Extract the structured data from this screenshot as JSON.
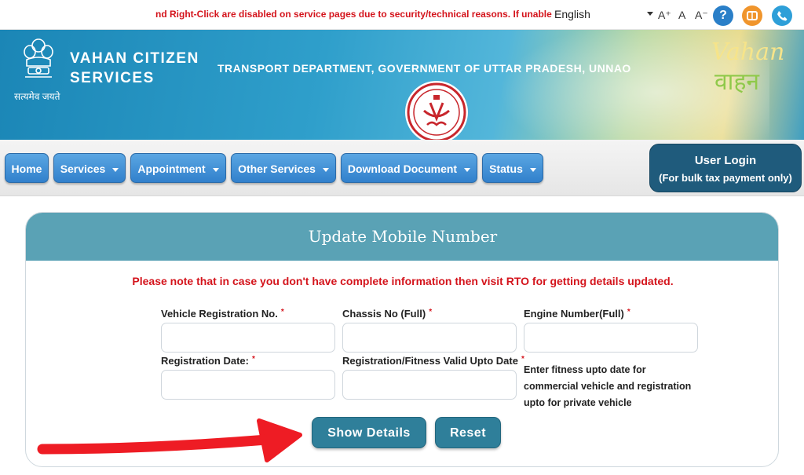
{
  "topbar": {
    "notice": "nd Right-Click are disabled on service pages due to security/technical reasons. If unable to",
    "language": "English",
    "font_increase": "A⁺",
    "font_normal": "A",
    "font_decrease": "A⁻",
    "help_icon_glyph": "?"
  },
  "header": {
    "brand_line1": "VAHAN CITIZEN",
    "brand_line2": "SERVICES",
    "emblem_caption": "सत्यमेव जयते",
    "department": "TRANSPORT DEPARTMENT, GOVERNMENT OF UTTAR PRADESH, UNNAO",
    "logo_text_en": "Vahan",
    "logo_text_hi": "वाहन"
  },
  "nav": {
    "items": [
      {
        "label": "Home"
      },
      {
        "label": "Services"
      },
      {
        "label": "Appointment"
      },
      {
        "label": "Other Services"
      },
      {
        "label": "Download Document"
      },
      {
        "label": "Status"
      }
    ],
    "login_title": "User Login",
    "login_sub": "(For bulk tax payment only)"
  },
  "form": {
    "title": "Update Mobile Number",
    "note": "Please note that in case you don't have complete information then visit RTO for getting details updated.",
    "fields": {
      "reg_no": {
        "label": "Vehicle Registration No.",
        "value": ""
      },
      "chassis": {
        "label": "Chassis No (Full)",
        "value": ""
      },
      "engine": {
        "label": "Engine Number(Full)",
        "value": ""
      },
      "reg_date": {
        "label": "Registration Date:",
        "value": ""
      },
      "valid_upto": {
        "label": "Registration/Fitness Valid Upto Date",
        "value": ""
      }
    },
    "required_mark": "*",
    "hint_line1": "Enter fitness upto date for",
    "hint_line2": "commercial vehicle and registration",
    "hint_line3": "upto for private vehicle",
    "show_details_label": "Show Details",
    "reset_label": "Reset"
  },
  "colors": {
    "nav_blue": "#3d8ed6",
    "header_teal": "#5aa2b5",
    "action_teal": "#2f7f9a",
    "alert_red": "#d4141c",
    "login_navy": "#1f5b7c"
  }
}
